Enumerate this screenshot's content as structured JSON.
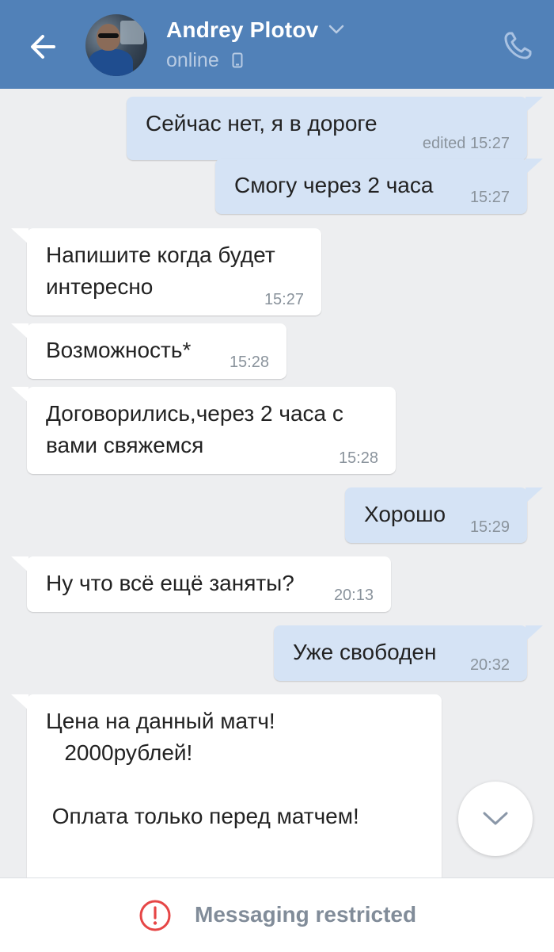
{
  "header": {
    "name": "Andrey Plotov",
    "status": "online",
    "back_icon": "arrow-left-icon",
    "call_icon": "phone-icon",
    "dropdown_icon": "chevron-down-icon",
    "device_icon": "mobile-phone-icon",
    "background_color": "#5181b8"
  },
  "messages": [
    {
      "direction": "out",
      "text": "Сейчас нет, я в дороге",
      "time": "edited 15:27"
    },
    {
      "direction": "out",
      "text": "Смогу через 2 часа",
      "time": "15:27"
    },
    {
      "direction": "in",
      "text": "Напишите когда будет\nинтересно",
      "time": "15:27"
    },
    {
      "direction": "in",
      "text": "Возможность*",
      "time": "15:28"
    },
    {
      "direction": "in",
      "text": "Договорились,через 2 часа с\nвами свяжемся",
      "time": "15:28"
    },
    {
      "direction": "out",
      "text": "Хорошо",
      "time": "15:29"
    },
    {
      "direction": "in",
      "text": "Ну что всё ещё заняты?",
      "time": "20:13"
    },
    {
      "direction": "out",
      "text": "Уже свободен",
      "time": "20:32"
    },
    {
      "direction": "in",
      "text": "Цена на данный матч!\n   2000рублей!\n\n Оплата только перед матчем!\n\n ...",
      "time": ""
    }
  ],
  "scroll_button": {
    "icon": "chevron-down-icon"
  },
  "footer": {
    "icon": "alert-circle-icon",
    "text": "Messaging restricted",
    "icon_color": "#e64646"
  }
}
